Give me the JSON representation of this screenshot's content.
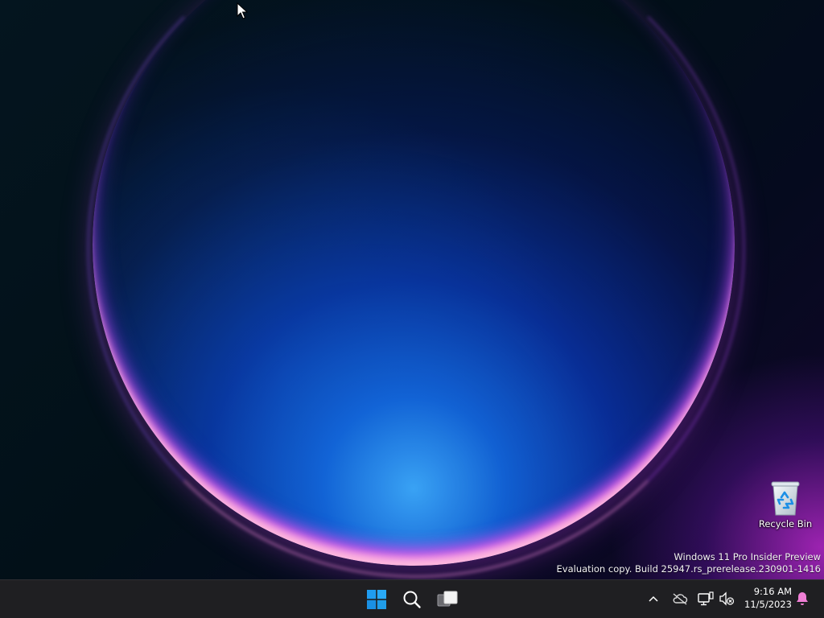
{
  "desktop": {
    "icons": [
      {
        "label": "Recycle Bin",
        "icon": "recycle-bin-icon"
      }
    ],
    "watermark": {
      "line1": "Windows 11 Pro Insider Preview",
      "line2": "Evaluation copy. Build 25947.rs_prerelease.230901-1416"
    }
  },
  "taskbar": {
    "pinned": [
      {
        "name": "Start",
        "icon": "windows-logo-icon"
      },
      {
        "name": "Search",
        "icon": "search-icon"
      },
      {
        "name": "Task View",
        "icon": "task-view-icon"
      }
    ],
    "tray": [
      {
        "name": "Show hidden icons",
        "icon": "chevron-up-icon"
      },
      {
        "name": "OneDrive",
        "icon": "onedrive-offline-icon"
      },
      {
        "name": "Network",
        "icon": "network-icon"
      },
      {
        "name": "Volume",
        "icon": "volume-muted-icon"
      }
    ],
    "clock": {
      "time": "9:16 AM",
      "date": "11/5/2023"
    },
    "notifications": {
      "icon": "notification-bell-icon"
    }
  },
  "colors": {
    "taskbar_bg": "#1f1f22",
    "windows_blue": "#29a3f0",
    "notification_pink": "#ef7fd5"
  }
}
